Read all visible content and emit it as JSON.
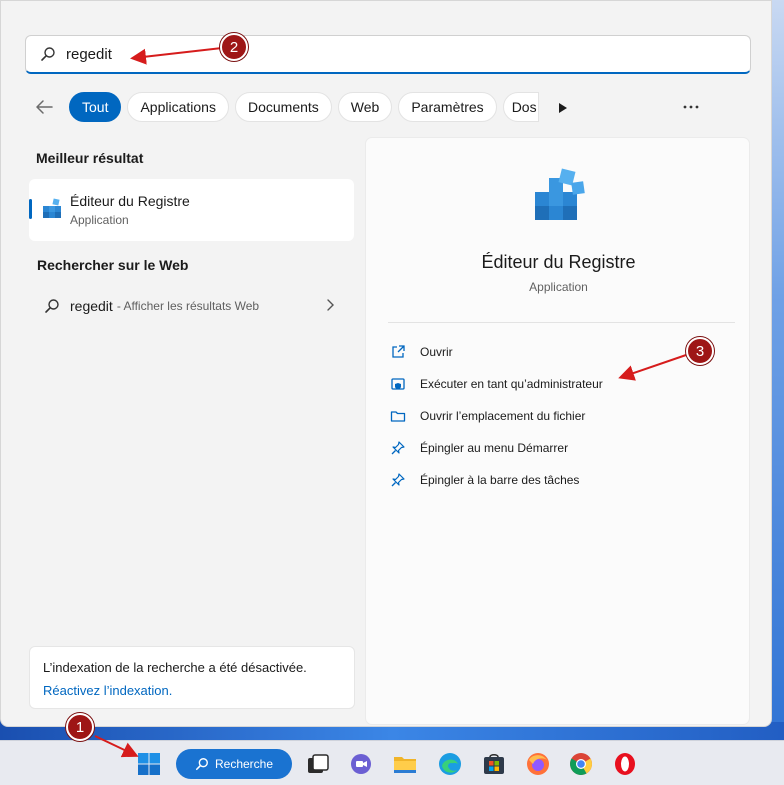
{
  "search": {
    "value": "regedit"
  },
  "filters": [
    {
      "label": "Tout",
      "active": true
    },
    {
      "label": "Applications"
    },
    {
      "label": "Documents"
    },
    {
      "label": "Web"
    },
    {
      "label": "Paramètres"
    },
    {
      "label": "Dos"
    }
  ],
  "best_match": {
    "section_title": "Meilleur résultat",
    "name": "Éditeur du Registre",
    "type": "Application"
  },
  "web": {
    "section_title": "Rechercher sur le Web",
    "query": "regedit",
    "hint": "- Afficher les résultats Web"
  },
  "indexing": {
    "message": "L’indexation de la recherche a été désactivée.",
    "link": "Réactivez l’indexation."
  },
  "detail": {
    "title": "Éditeur du Registre",
    "subtitle": "Application",
    "actions": [
      {
        "label": "Ouvrir",
        "icon": "open-external-icon"
      },
      {
        "label": "Exécuter en tant qu’administrateur",
        "icon": "shield-run-admin-icon"
      },
      {
        "label": "Ouvrir l’emplacement du fichier",
        "icon": "folder-icon"
      },
      {
        "label": "Épingler au menu Démarrer",
        "icon": "pin-icon"
      },
      {
        "label": "Épingler à la barre des tâches",
        "icon": "pin-icon"
      }
    ]
  },
  "annotations": [
    "1",
    "2",
    "3"
  ],
  "taskbar": {
    "search_label": "Recherche",
    "icons": [
      "start-windows-icon",
      "task-view-icon",
      "teams-chat-icon",
      "file-explorer-icon",
      "edge-icon",
      "store-icon",
      "firefox-icon",
      "chrome-icon",
      "opera-icon"
    ]
  },
  "colors": {
    "accent": "#0067c0",
    "annotation": "#9e1616",
    "arrow": "#d61c1c"
  }
}
